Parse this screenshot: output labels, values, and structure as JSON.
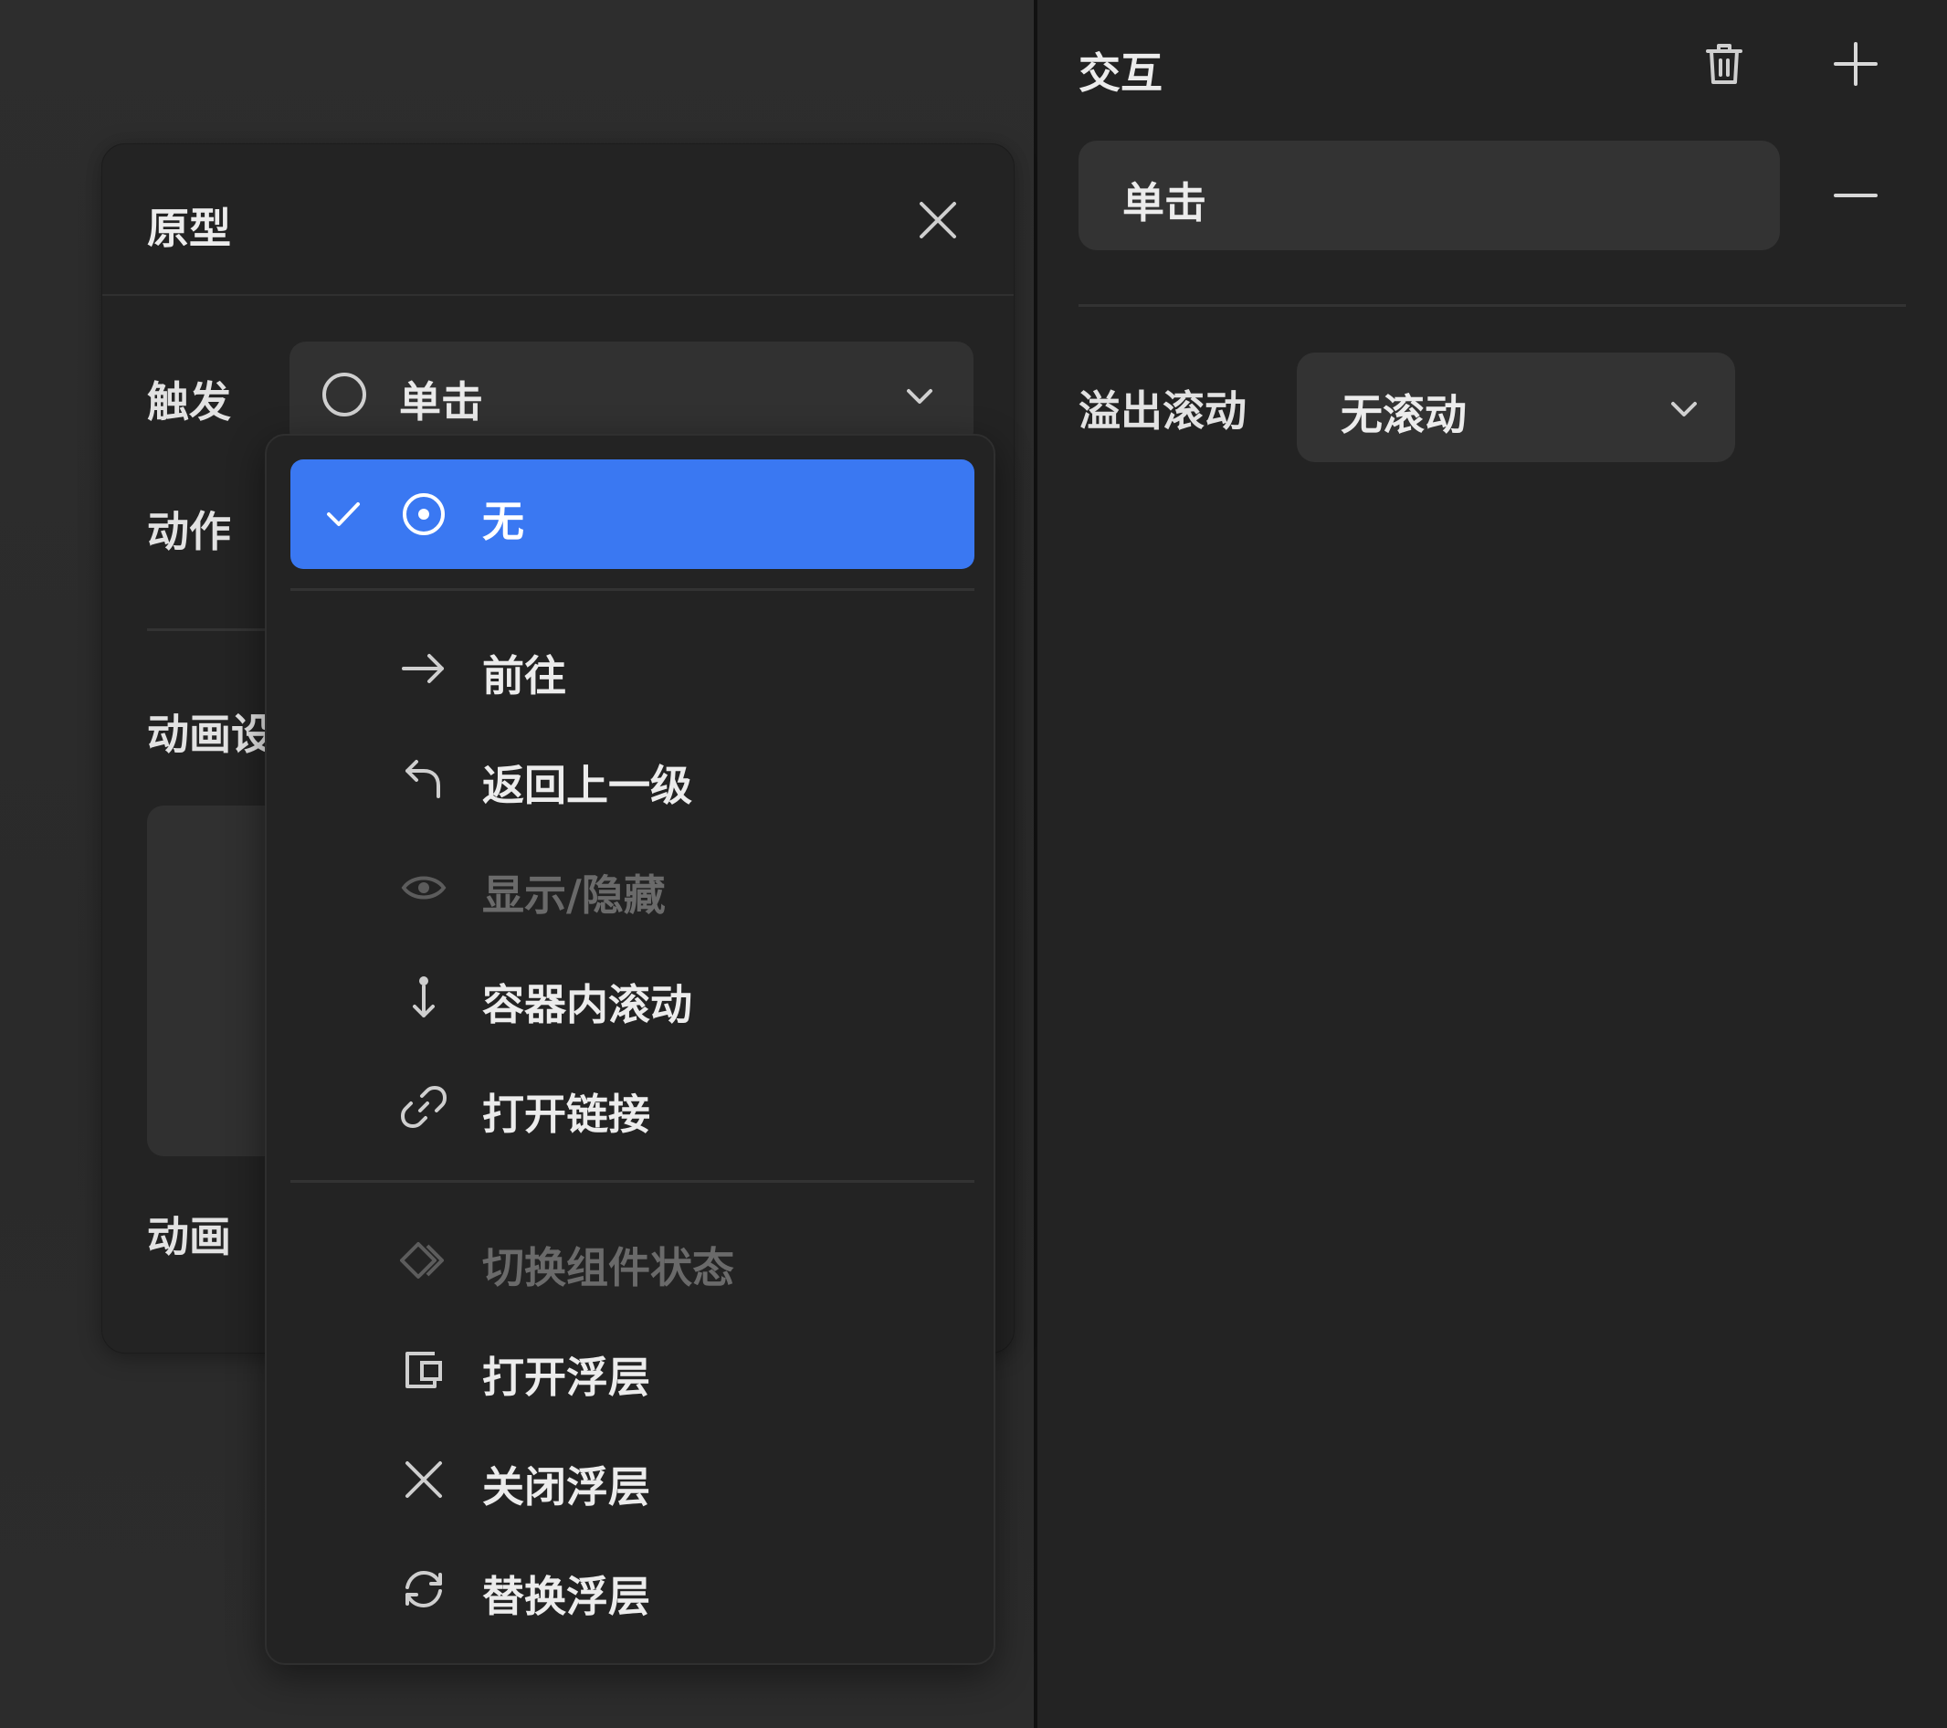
{
  "prototype_panel": {
    "title": "原型",
    "close_icon": "close-icon",
    "rows": {
      "trigger_label": "触发",
      "action_label": "动作",
      "animation_settings_label": "动画设",
      "animation_label": "动画"
    },
    "trigger_select": {
      "value": "单击",
      "icon": "circle-icon"
    }
  },
  "action_dropdown": {
    "items": [
      {
        "label": "无",
        "icon": "target-circle-icon",
        "selected": true,
        "disabled": false
      },
      {
        "label": "前往",
        "icon": "arrow-right-icon",
        "selected": false,
        "disabled": false
      },
      {
        "label": "返回上一级",
        "icon": "return-arrow-icon",
        "selected": false,
        "disabled": false
      },
      {
        "label": "显示/隐藏",
        "icon": "eye-icon",
        "selected": false,
        "disabled": true
      },
      {
        "label": "容器内滚动",
        "icon": "scroll-down-icon",
        "selected": false,
        "disabled": false
      },
      {
        "label": "打开链接",
        "icon": "link-icon",
        "selected": false,
        "disabled": false
      },
      {
        "label": "切换组件状态",
        "icon": "diamond-swap-icon",
        "selected": false,
        "disabled": true
      },
      {
        "label": "打开浮层",
        "icon": "open-overlay-icon",
        "selected": false,
        "disabled": false
      },
      {
        "label": "关闭浮层",
        "icon": "close-icon",
        "selected": false,
        "disabled": false
      },
      {
        "label": "替换浮层",
        "icon": "replace-cycle-icon",
        "selected": false,
        "disabled": false
      }
    ]
  },
  "interaction_panel": {
    "title": "交互",
    "trash_icon": "trash-icon",
    "plus_icon": "plus-icon",
    "minus_icon": "minus-icon",
    "trigger_value": "单击",
    "overflow_label": "溢出滚动",
    "overflow_value": "无滚动"
  },
  "colors": {
    "accent": "#3a78f2",
    "panel_bg": "#232323",
    "field_bg": "#313131",
    "text": "#ececec",
    "disabled_text": "#6a6a6a"
  }
}
